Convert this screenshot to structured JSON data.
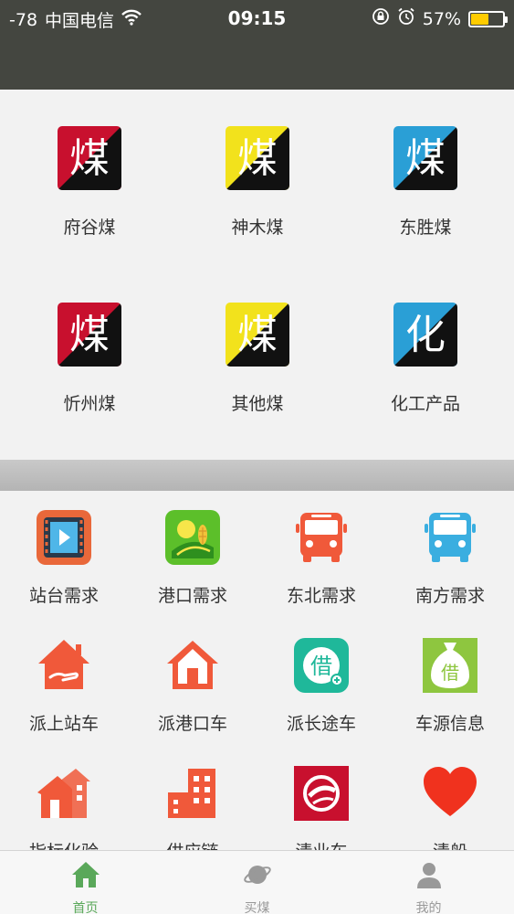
{
  "status_bar": {
    "signal": "-78",
    "carrier": "中国电信",
    "time": "09:15",
    "battery": "57%",
    "battery_level": 0.57
  },
  "coal_categories": [
    {
      "label": "府谷煤",
      "icon_char": "煤",
      "color": "#c8102e"
    },
    {
      "label": "神木煤",
      "icon_char": "煤",
      "color": "#f2e21c"
    },
    {
      "label": "东胜煤",
      "icon_char": "煤",
      "color": "#2a9fd6"
    },
    {
      "label": "忻州煤",
      "icon_char": "煤",
      "color": "#c8102e"
    },
    {
      "label": "其他煤",
      "icon_char": "煤",
      "color": "#f2e21c"
    },
    {
      "label": "化工产品",
      "icon_char": "化",
      "color": "#2a9fd6"
    }
  ],
  "services": [
    {
      "label": "站台需求",
      "icon": "film-icon"
    },
    {
      "label": "港口需求",
      "icon": "farm-icon"
    },
    {
      "label": "东北需求",
      "icon": "bus-icon",
      "color": "#f0593a"
    },
    {
      "label": "南方需求",
      "icon": "bus-icon",
      "color": "#3aaee0"
    },
    {
      "label": "派上站车",
      "icon": "house-hand-icon"
    },
    {
      "label": "派港口车",
      "icon": "house-icon"
    },
    {
      "label": "派长途车",
      "icon": "loan-icon",
      "char": "借"
    },
    {
      "label": "车源信息",
      "icon": "money-bag-icon",
      "char": "借"
    },
    {
      "label": "指标化验",
      "icon": "houses-icon"
    },
    {
      "label": "供应链",
      "icon": "buildings-icon"
    },
    {
      "label": "清业车",
      "icon": "logo-icon"
    },
    {
      "label": "清船",
      "icon": "heart-icon"
    }
  ],
  "tabs": [
    {
      "label": "首页",
      "icon": "home-icon",
      "active": true
    },
    {
      "label": "买煤",
      "icon": "planet-icon",
      "active": false
    },
    {
      "label": "我的",
      "icon": "user-icon",
      "active": false
    }
  ]
}
